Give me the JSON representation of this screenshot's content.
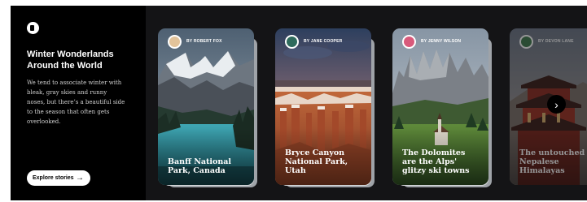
{
  "intro": {
    "title": "Winter Wonderlands Around the World",
    "description": "We tend to associate winter with bleak, gray skies and runny noses, but there’s a beautiful side to the season that often gets overlooked.",
    "explore_label": "Explore stories",
    "explore_icon": "arrow-right-icon"
  },
  "cards": [
    {
      "author": "BY ROBERT FOX",
      "title": "Banff National Park, Canada"
    },
    {
      "author": "BY JANE COOPER",
      "title": "Bryce Canyon National Park, Utah"
    },
    {
      "author": "BY JENNY WILSON",
      "title": "The Dolomites are the Alps' glitzy ski towns"
    },
    {
      "author": "BY DEVON LANE",
      "title": "The untouched Nepalese Himalayas"
    }
  ],
  "carousel": {
    "next_icon": "chevron-right-icon"
  },
  "colors": {
    "panel": "#000000",
    "background": "#141416",
    "button": "#ffffff"
  }
}
